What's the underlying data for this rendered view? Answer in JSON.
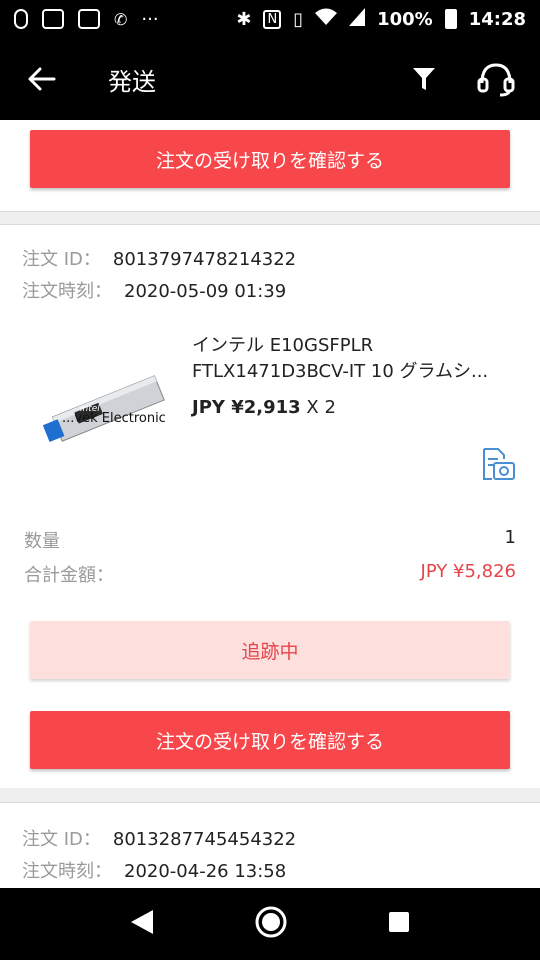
{
  "status_bar": {
    "battery": "100%",
    "time": "14:28",
    "dots": "···"
  },
  "header": {
    "title": "発送"
  },
  "top_card": {
    "confirm_label": "注文の受け取りを確認する"
  },
  "orders": [
    {
      "id_label": "注文 ID：",
      "id": "8013797478214322",
      "time_label": "注文時刻：",
      "time": "2020-05-09 01:39",
      "product_line1": "インテル E10GSFPLR",
      "product_line2": "FTLX1471D3BCV-IT 10 グラムシ...",
      "price": "JPY ¥2,913",
      "qty_multiplier": "X 2",
      "thumb_brand": "intel",
      "thumb_text": "...vek Electronic",
      "qty_label": "数量",
      "qty_value": "1",
      "total_label": "合計金額：",
      "total_value": "JPY ¥5,826",
      "tracking_label": "追跡中",
      "confirm_label": "注文の受け取りを確認する"
    },
    {
      "id_label": "注文 ID：",
      "id": "8013287745454322",
      "time_label": "注文時刻：",
      "time": "2020-04-26 13:58"
    }
  ],
  "colors": {
    "accent": "#f7474b",
    "tracking_bg": "#fde0de",
    "price_red": "#e8454a",
    "header_bg": "#000000",
    "link_blue": "#4a8fd4"
  },
  "icons": {
    "back": "arrow-left-icon",
    "filter": "filter-icon",
    "support": "headset-icon",
    "photo_review": "review-camera-icon",
    "nav_back": "triangle-back-icon",
    "nav_home": "circle-home-icon",
    "nav_recent": "square-recent-icon"
  }
}
